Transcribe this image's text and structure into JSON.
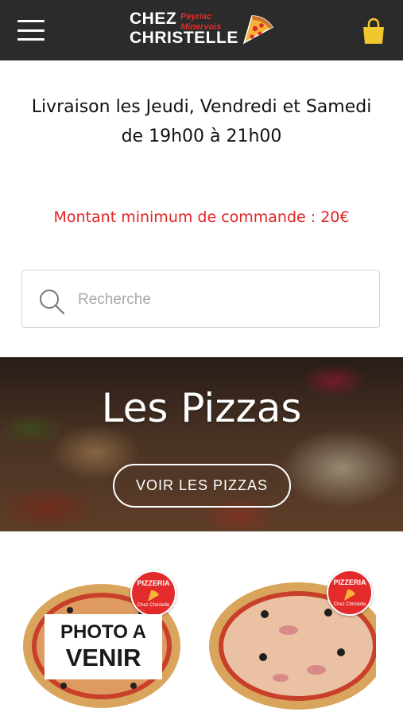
{
  "header": {
    "brand_line1": "CHEZ",
    "brand_line2": "CHRISTELLE",
    "brand_sub1": "Peyriac",
    "brand_sub2": "Minervois",
    "menu_icon": "hamburger-menu-icon",
    "cart_icon": "shopping-bag-icon"
  },
  "info": {
    "delivery_line1": "Livraison les Jeudi, Vendredi et Samedi",
    "delivery_line2": "de 19h00 à 21h00",
    "minimum_order": "Montant minimum de commande : 20€"
  },
  "search": {
    "placeholder": "Recherche",
    "value": ""
  },
  "hero": {
    "title": "Les Pizzas",
    "button_label": "VOIR LES PIZZAS"
  },
  "products": [
    {
      "badge_line1": "PIZZERIA",
      "badge_line2": "Chez Christelle",
      "photo_label_line1": "PHOTO A",
      "photo_label_line2": "VENIR"
    },
    {
      "badge_line1": "PIZZERIA",
      "badge_line2": "Chez Christelle"
    }
  ],
  "colors": {
    "header_bg": "#2b2b2b",
    "accent_red": "#e32525",
    "cart_yellow": "#f2c62f"
  }
}
